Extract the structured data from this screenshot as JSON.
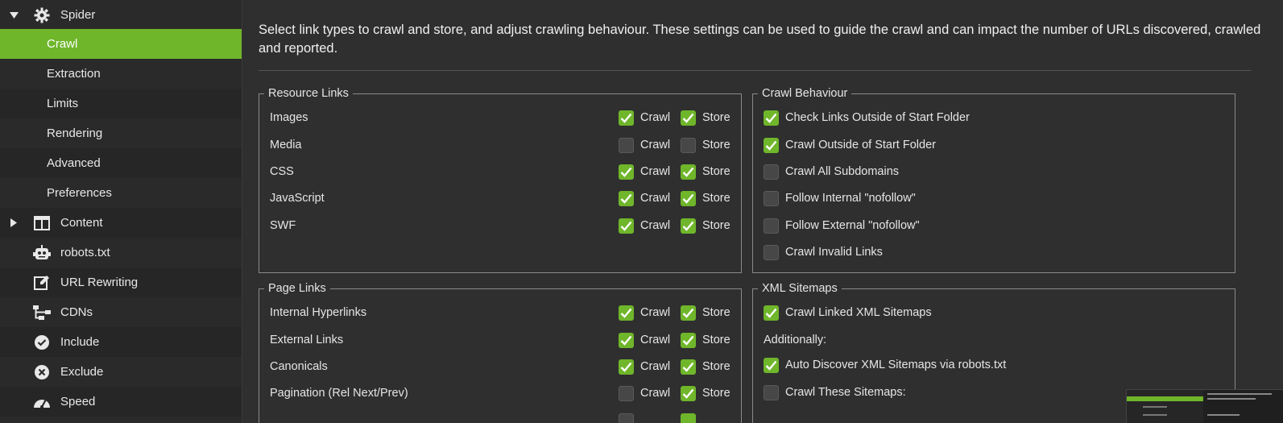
{
  "sidebar": {
    "items": [
      {
        "label": "Spider",
        "icon": "gear-icon",
        "arrow": "down",
        "level": 0
      },
      {
        "label": "Crawl",
        "level": 1,
        "active": true
      },
      {
        "label": "Extraction",
        "level": 1
      },
      {
        "label": "Limits",
        "level": 1
      },
      {
        "label": "Rendering",
        "level": 1
      },
      {
        "label": "Advanced",
        "level": 1
      },
      {
        "label": "Preferences",
        "level": 1
      },
      {
        "label": "Content",
        "icon": "columns-icon",
        "arrow": "right",
        "level": 0
      },
      {
        "label": "robots.txt",
        "icon": "robot-icon",
        "level": 0
      },
      {
        "label": "URL Rewriting",
        "icon": "edit-icon",
        "level": 0
      },
      {
        "label": "CDNs",
        "icon": "network-icon",
        "level": 0
      },
      {
        "label": "Include",
        "icon": "check-circle-icon",
        "level": 0
      },
      {
        "label": "Exclude",
        "icon": "x-circle-icon",
        "level": 0
      },
      {
        "label": "Speed",
        "icon": "gauge-icon",
        "level": 0
      }
    ]
  },
  "main": {
    "description": "Select link types to crawl and store, and adjust crawling behaviour. These settings can be used to guide the crawl and can impact the number of URLs discovered, crawled and reported.",
    "crawl_label": "Crawl",
    "store_label": "Store",
    "resource_links": {
      "title": "Resource Links",
      "rows": [
        {
          "label": "Images",
          "crawl": true,
          "store": true
        },
        {
          "label": "Media",
          "crawl": false,
          "store": false
        },
        {
          "label": "CSS",
          "crawl": true,
          "store": true
        },
        {
          "label": "JavaScript",
          "crawl": true,
          "store": true
        },
        {
          "label": "SWF",
          "crawl": true,
          "store": true
        }
      ]
    },
    "page_links": {
      "title": "Page Links",
      "rows": [
        {
          "label": "Internal Hyperlinks",
          "crawl": true,
          "store": true
        },
        {
          "label": "External Links",
          "crawl": true,
          "store": true
        },
        {
          "label": "Canonicals",
          "crawl": true,
          "store": true
        },
        {
          "label": "Pagination (Rel Next/Prev)",
          "crawl": false,
          "store": true
        }
      ]
    },
    "crawl_behaviour": {
      "title": "Crawl Behaviour",
      "options": [
        {
          "label": "Check Links Outside of Start Folder",
          "checked": true
        },
        {
          "label": "Crawl Outside of Start Folder",
          "checked": true
        },
        {
          "label": "Crawl All Subdomains",
          "checked": false
        },
        {
          "label": "Follow Internal \"nofollow\"",
          "checked": false
        },
        {
          "label": "Follow External \"nofollow\"",
          "checked": false
        },
        {
          "label": "Crawl Invalid Links",
          "checked": false
        }
      ]
    },
    "xml_sitemaps": {
      "title": "XML Sitemaps",
      "crawl_linked": {
        "label": "Crawl Linked XML Sitemaps",
        "checked": true
      },
      "additionally": "Additionally:",
      "auto_discover": {
        "label": "Auto Discover XML Sitemaps via robots.txt",
        "checked": true
      },
      "crawl_these": {
        "label": "Crawl These Sitemaps:",
        "checked": false
      }
    }
  },
  "colors": {
    "accent": "#6fb62b",
    "background": "#2f2f2f",
    "sidebar": "#2a2a2a"
  }
}
